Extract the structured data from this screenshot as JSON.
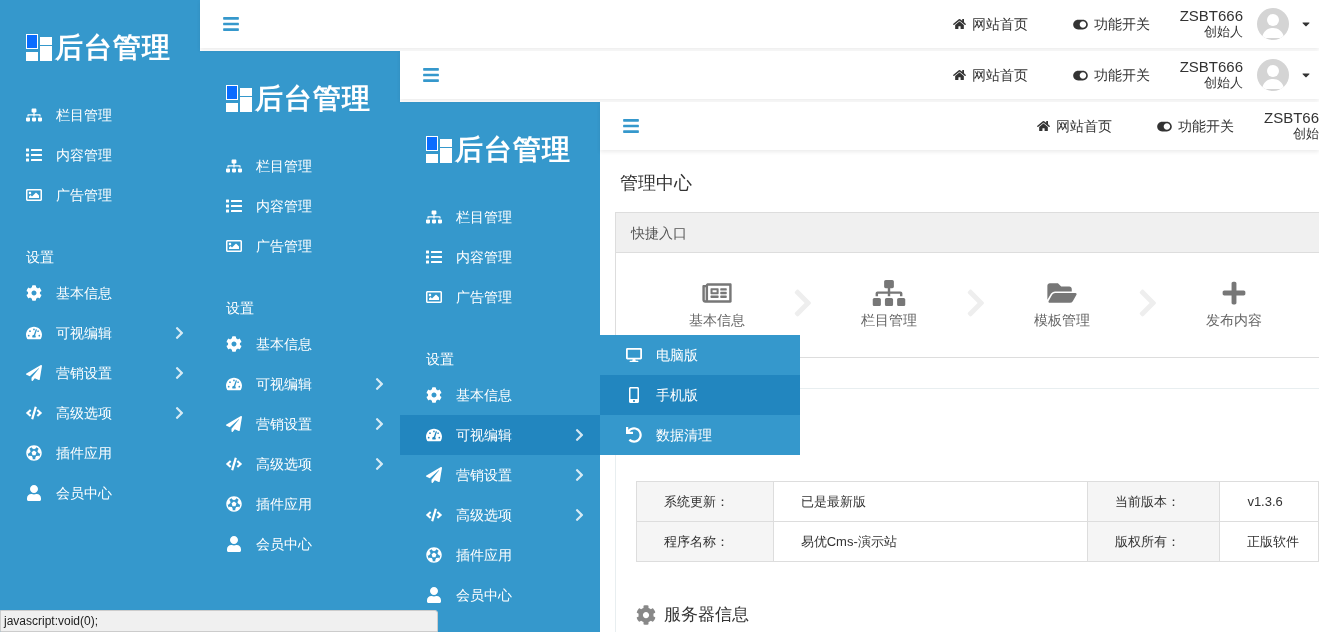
{
  "layers": [
    {
      "logo": "后台管理",
      "header": {
        "links": [
          "网站首页",
          "功能开关"
        ],
        "user": {
          "name": "ZSBT666",
          "role": "创始人",
          "avatar": true
        }
      },
      "nav": [
        {
          "label": "栏目管理",
          "expandable": false,
          "selected": false
        },
        {
          "label": "内容管理",
          "expandable": false,
          "selected": false
        },
        {
          "label": "广告管理",
          "expandable": false,
          "selected": false
        }
      ],
      "section": "设置",
      "settings": [
        {
          "label": "基本信息",
          "expandable": false,
          "selected": false
        },
        {
          "label": "可视编辑",
          "expandable": true,
          "selected": false
        },
        {
          "label": "营销设置",
          "expandable": true,
          "selected": false
        },
        {
          "label": "高级选项",
          "expandable": true,
          "selected": false
        },
        {
          "label": "插件应用",
          "expandable": false,
          "selected": false
        },
        {
          "label": "会员中心",
          "expandable": false,
          "selected": false
        }
      ]
    },
    {
      "logo": "后台管理",
      "header": {
        "links": [
          "网站首页",
          "功能开关"
        ],
        "user": {
          "name": "ZSBT666",
          "role": "创始人",
          "avatar": true
        }
      },
      "nav": [
        {
          "label": "栏目管理",
          "expandable": false,
          "selected": false
        },
        {
          "label": "内容管理",
          "expandable": false,
          "selected": false
        },
        {
          "label": "广告管理",
          "expandable": false,
          "selected": false
        }
      ],
      "section": "设置",
      "settings": [
        {
          "label": "基本信息",
          "expandable": false,
          "selected": false
        },
        {
          "label": "可视编辑",
          "expandable": true,
          "selected": false
        },
        {
          "label": "营销设置",
          "expandable": true,
          "selected": false
        },
        {
          "label": "高级选项",
          "expandable": true,
          "selected": false
        },
        {
          "label": "插件应用",
          "expandable": false,
          "selected": false
        },
        {
          "label": "会员中心",
          "expandable": false,
          "selected": false
        }
      ]
    },
    {
      "logo": "后台管理",
      "header": {
        "links": [
          "网站首页",
          "功能开关"
        ],
        "user": {
          "name": "ZSBT66",
          "role": "创始",
          "avatar": false
        }
      },
      "nav": [
        {
          "label": "栏目管理",
          "expandable": false,
          "selected": false
        },
        {
          "label": "内容管理",
          "expandable": false,
          "selected": false
        },
        {
          "label": "广告管理",
          "expandable": false,
          "selected": false
        }
      ],
      "section": "设置",
      "settings": [
        {
          "label": "基本信息",
          "expandable": false,
          "selected": false
        },
        {
          "label": "可视编辑",
          "expandable": true,
          "selected": true
        },
        {
          "label": "营销设置",
          "expandable": true,
          "selected": false
        },
        {
          "label": "高级选项",
          "expandable": true,
          "selected": false
        },
        {
          "label": "插件应用",
          "expandable": false,
          "selected": false
        },
        {
          "label": "会员中心",
          "expandable": false,
          "selected": false
        }
      ],
      "flyout": [
        {
          "label": "电脑版",
          "selected": false
        },
        {
          "label": "手机版",
          "selected": true
        },
        {
          "label": "数据清理",
          "selected": false
        }
      ],
      "content": {
        "title": "管理中心",
        "quick": {
          "title": "快捷入口",
          "items": [
            "基本信息",
            "栏目管理",
            "模板管理",
            "发布内容"
          ]
        },
        "info": [
          [
            "系统更新：",
            "已是最新版",
            "当前版本：",
            "v1.3.6"
          ],
          [
            "程序名称：",
            "易优Cms-演示站",
            "版权所有：",
            "正版软件"
          ]
        ],
        "server_title": "服务器信息"
      }
    }
  ],
  "status_bar": "javascript:void(0);"
}
